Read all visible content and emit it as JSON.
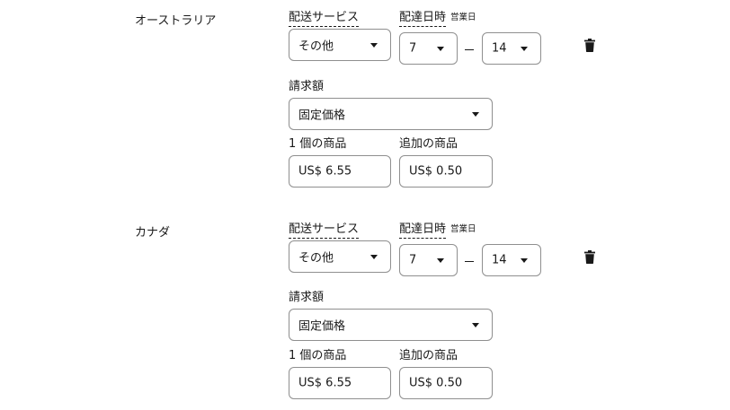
{
  "rows": [
    {
      "country": "オーストラリア",
      "service_label": "配送サービス",
      "service_value": "その他",
      "days_label": "配達日時",
      "days_sub": "営業日",
      "min_days": "7",
      "max_days": "14",
      "charge_label": "請求額",
      "charge_value": "固定価格",
      "first_item_label": "1 個の商品",
      "first_item_value": "US$ 6.55",
      "additional_label": "追加の商品",
      "additional_value": "US$ 0.50"
    },
    {
      "country": "カナダ",
      "service_label": "配送サービス",
      "service_value": "その他",
      "days_label": "配達日時",
      "days_sub": "営業日",
      "min_days": "7",
      "max_days": "14",
      "charge_label": "請求額",
      "charge_value": "固定価格",
      "first_item_label": "1 個の商品",
      "first_item_value": "US$ 6.55",
      "additional_label": "追加の商品",
      "additional_value": "US$ 0.50"
    }
  ],
  "icons": {
    "delete": "trash-icon",
    "dropdown": "chevron-down-icon"
  }
}
